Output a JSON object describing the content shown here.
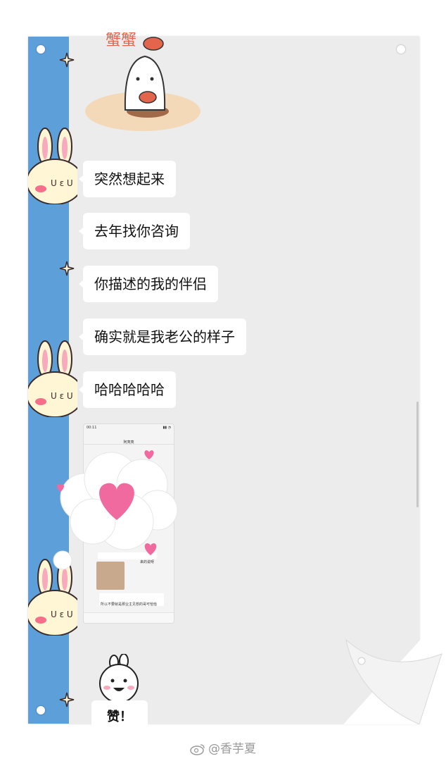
{
  "messages": [
    {
      "text": "突然想起来"
    },
    {
      "text": "去年找你咨询"
    },
    {
      "text": "你描述的我的伴侣"
    },
    {
      "text": "确实就是我老公的样子"
    },
    {
      "text": "哈哈哈哈哈"
    }
  ],
  "sticker_top": {
    "text": "蟹蟹"
  },
  "embedded_screenshot": {
    "status_time": "00:11",
    "contact_name": "阿夷夷",
    "snippet_1": "来的说呀",
    "snippet_2": "所以不要就是那业主见想的哥可恰恰"
  },
  "reply_sticker": {
    "text": "赞！"
  },
  "watermark": {
    "text": "@香芋夏"
  },
  "colors": {
    "strip": "#5d9fd9",
    "paper": "#ececec",
    "bubble": "#ffffff",
    "heart": "#f06aa0"
  }
}
